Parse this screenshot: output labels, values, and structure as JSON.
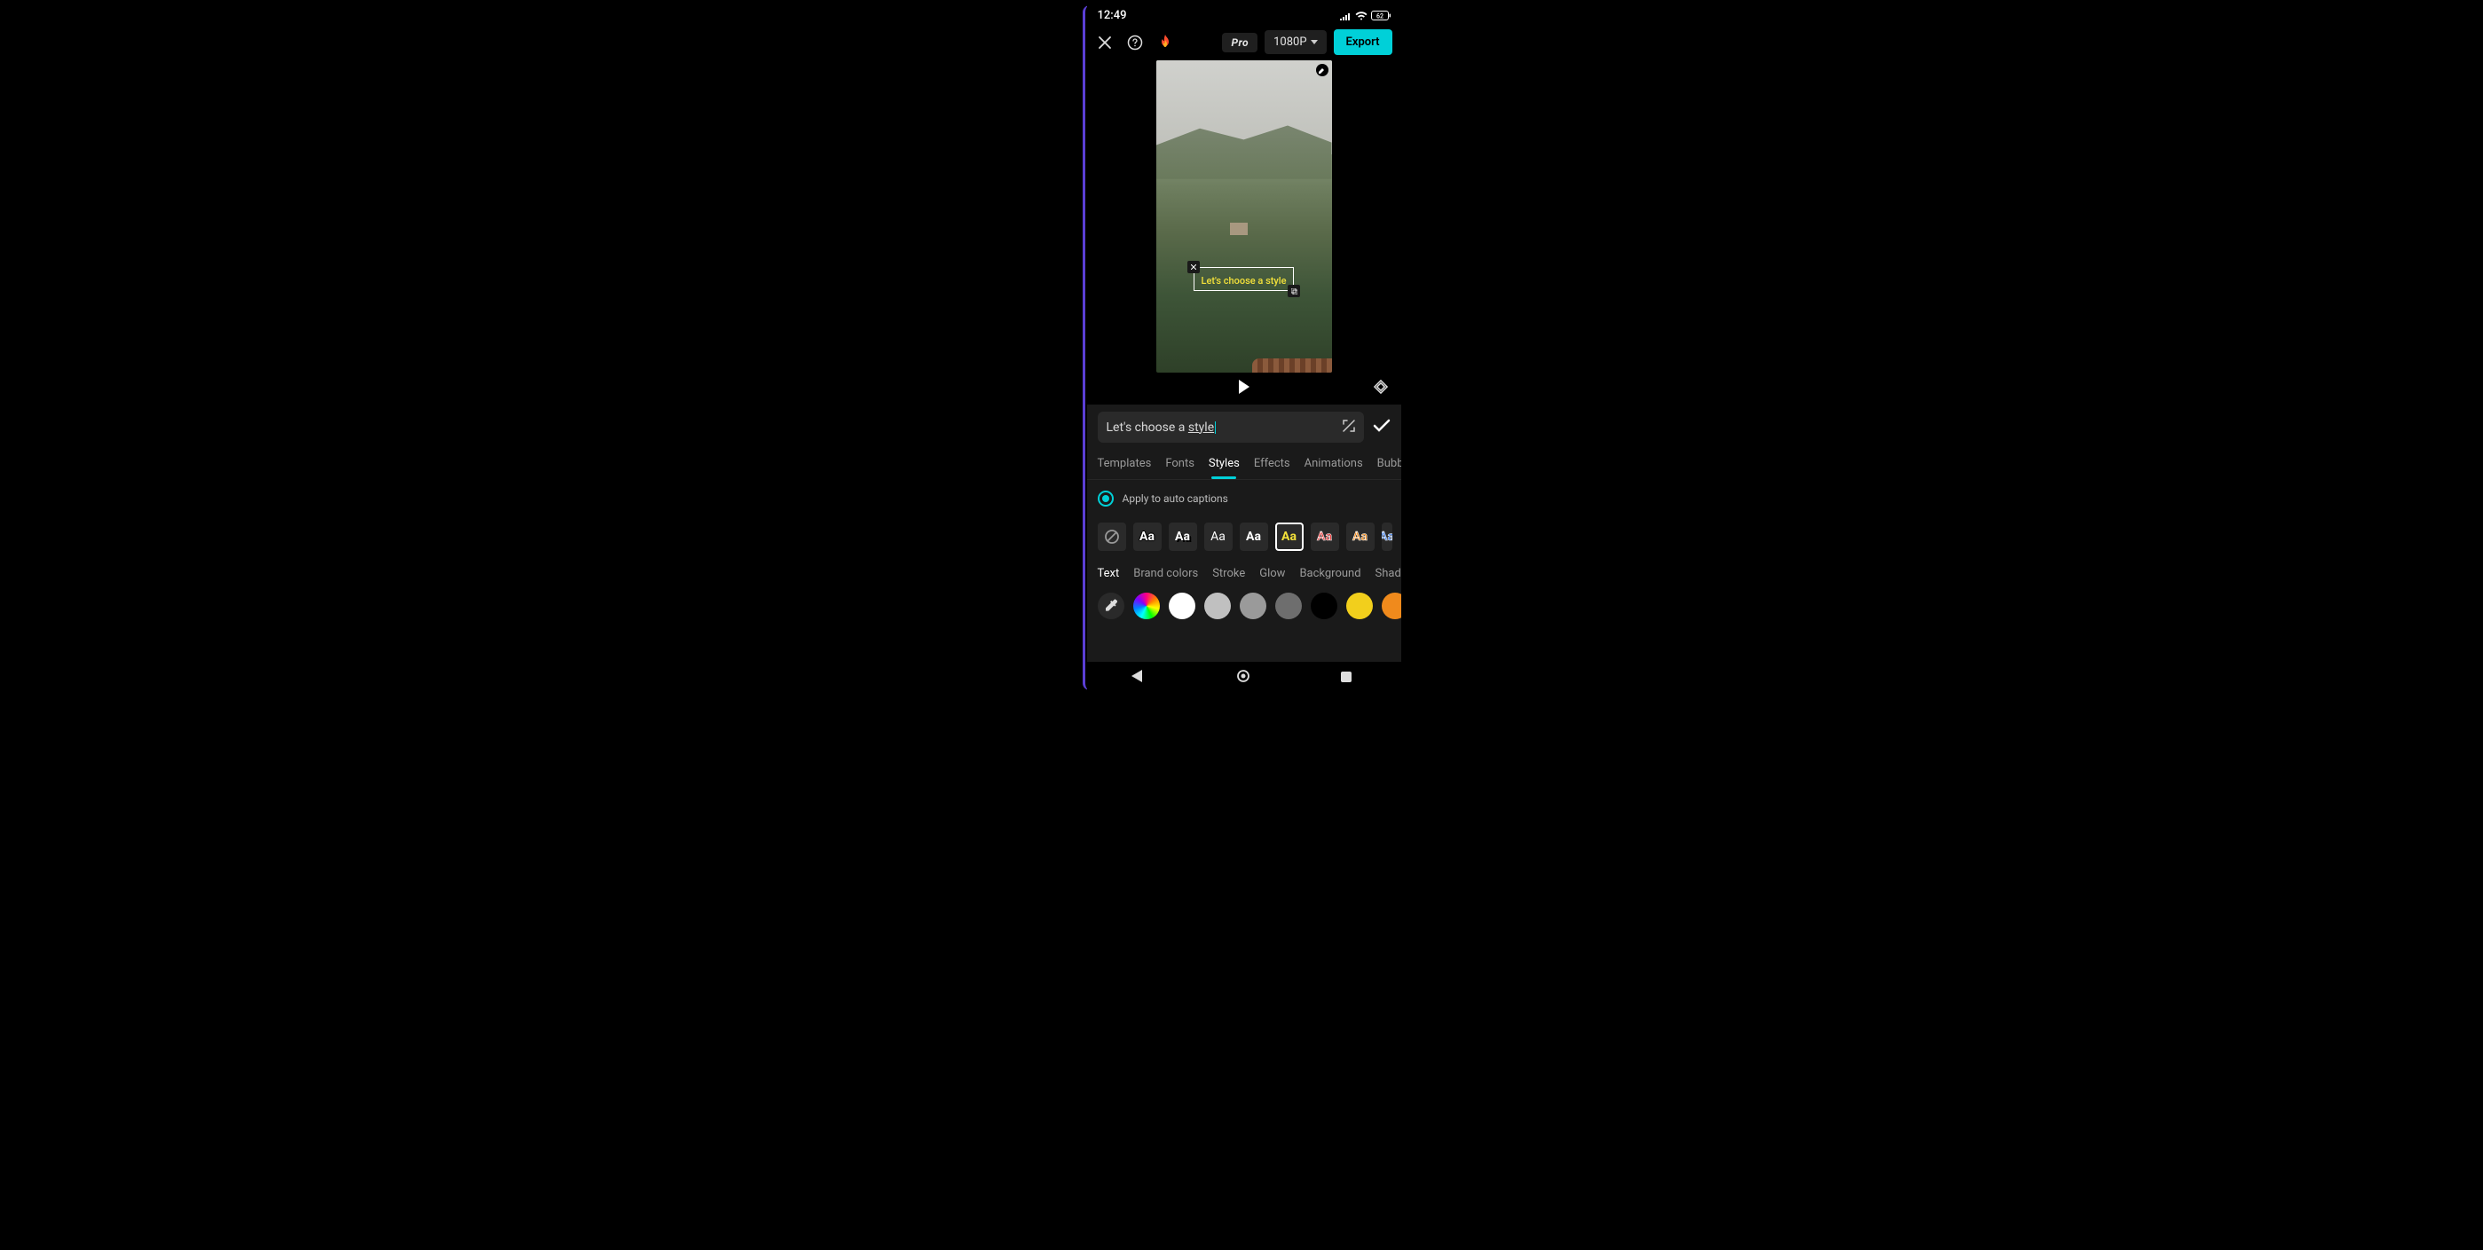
{
  "status": {
    "time": "12:49",
    "battery": "62"
  },
  "toolbar": {
    "pro_label": "Pro",
    "resolution": "1080P",
    "export_label": "Export"
  },
  "preview": {
    "caption_text": "Let's choose a style"
  },
  "editor": {
    "input_prefix": "Let's choose a ",
    "input_suffix": "style",
    "tabs": [
      "Templates",
      "Fonts",
      "Styles",
      "Effects",
      "Animations",
      "Bubb"
    ],
    "active_tab_index": 2,
    "apply_label": "Apply to auto captions",
    "preset_glyph": "Aa",
    "color_tabs": [
      "Text",
      "Brand colors",
      "Stroke",
      "Glow",
      "Background",
      "Shado"
    ],
    "active_color_tab_index": 0,
    "swatches": [
      "#ffffff",
      "#c0c0c0",
      "#9a9a9a",
      "#6e6e6e",
      "#000000",
      "#f2cf1c",
      "#f08a1c"
    ]
  }
}
